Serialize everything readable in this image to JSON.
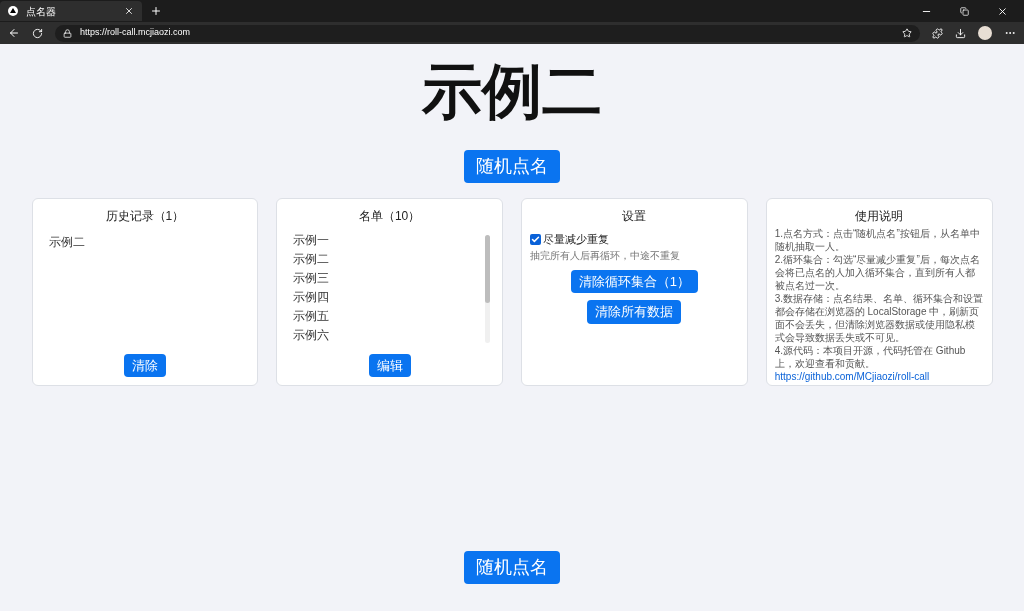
{
  "browser": {
    "tab_title": "点名器",
    "url": "https://roll-call.mcjiaozi.com"
  },
  "current_name": "示例二",
  "top_button": "随机点名",
  "history": {
    "title": "历史记录（1）",
    "items": [
      "示例二"
    ],
    "button": "清除"
  },
  "roster": {
    "title": "名单（10）",
    "items": [
      "示例一",
      "示例二",
      "示例三",
      "示例四",
      "示例五",
      "示例六"
    ],
    "button": "编辑"
  },
  "settings": {
    "title": "设置",
    "option": {
      "label": "尽量减少重复",
      "hint": "抽完所有人后再循环，中途不重复",
      "checked": true
    },
    "buttons": [
      "清除循环集合（1）",
      "清除所有数据"
    ]
  },
  "instructions": {
    "title": "使用说明",
    "paragraphs": [
      "1.点名方式：点击“随机点名”按钮后，从名单中随机抽取一人。",
      "2.循环集合：勾选“尽量减少重复”后，每次点名会将已点名的人加入循环集合，直到所有人都被点名过一次。",
      "3.数据存储：点名结果、名单、循环集合和设置都会存储在浏览器的 LocalStorage 中，刷新页面不会丢失，但清除浏览器数据或使用隐私模式会导致数据丢失或不可见。",
      "4.源代码：本项目开源，代码托管在 Github 上，欢迎查看和贡献。"
    ],
    "link": "https://github.com/MCjiaozi/roll-call"
  },
  "bottom_button": "随机点名"
}
